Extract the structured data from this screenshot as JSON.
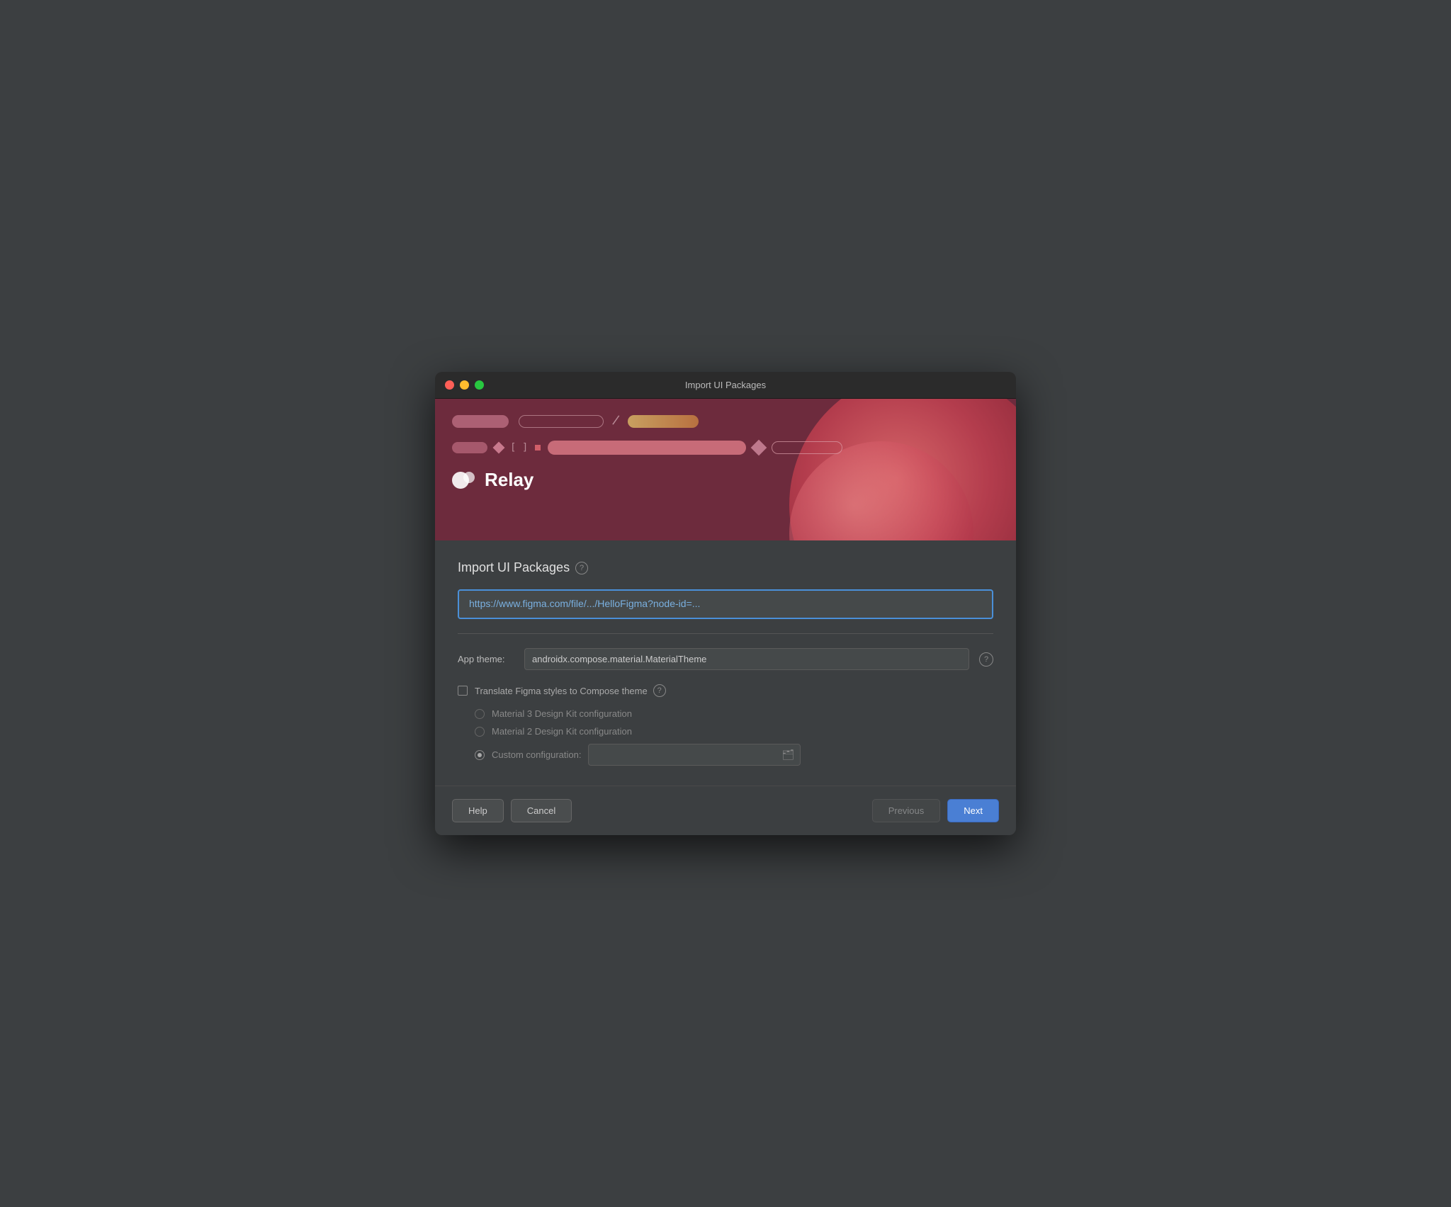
{
  "window": {
    "title": "Import UI Packages"
  },
  "banner": {
    "relay_label": "Relay"
  },
  "main": {
    "section_title": "Import UI Packages",
    "help_icon_label": "?",
    "url_input_value": "https://www.figma.com/file/.../HelloFigma?node-id=...",
    "url_input_placeholder": "https://www.figma.com/file/.../HelloFigma?node-id=...",
    "app_theme_label": "App theme:",
    "app_theme_value": "androidx.compose.material.MaterialTheme",
    "translate_label": "Translate Figma styles to Compose theme",
    "radio_options": [
      {
        "id": "material3",
        "label": "Material 3 Design Kit configuration",
        "selected": false
      },
      {
        "id": "material2",
        "label": "Material 2 Design Kit configuration",
        "selected": false
      },
      {
        "id": "custom",
        "label": "Custom configuration:",
        "selected": true
      }
    ],
    "custom_config_value": ""
  },
  "footer": {
    "help_label": "Help",
    "cancel_label": "Cancel",
    "previous_label": "Previous",
    "next_label": "Next"
  }
}
